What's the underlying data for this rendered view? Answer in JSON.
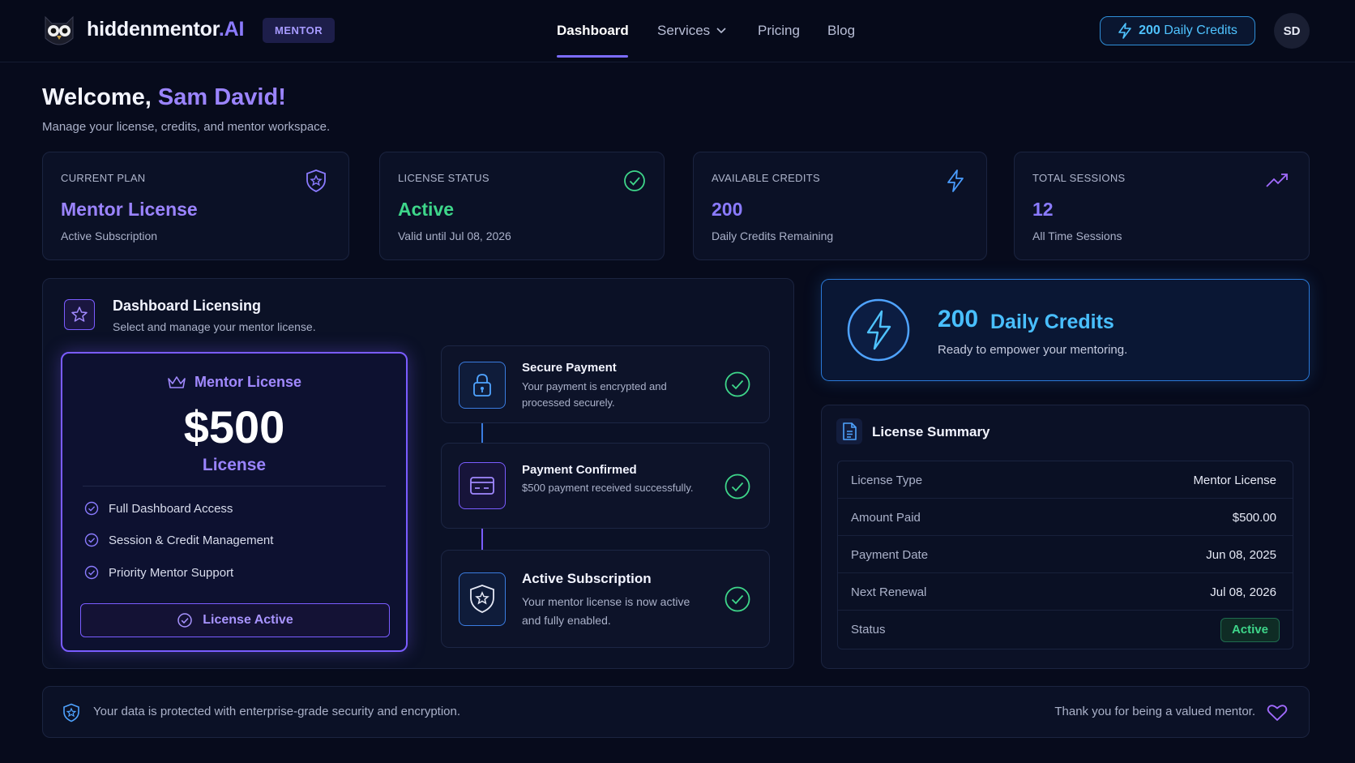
{
  "header": {
    "brand_main": "hiddenmentor",
    "brand_suffix": ".AI",
    "role_badge": "MENTOR",
    "nav": [
      {
        "label": "Dashboard",
        "active": true
      },
      {
        "label": "Services",
        "dropdown": true
      },
      {
        "label": "Pricing"
      },
      {
        "label": "Blog"
      }
    ],
    "credits_value": "200",
    "credits_label": "Daily Credits",
    "avatar_initials": "SD"
  },
  "welcome": {
    "greeting": "Welcome,",
    "name": "Sam David!",
    "subtitle": "Manage your license, credits, and mentor workspace."
  },
  "stats": [
    {
      "label": "CURRENT PLAN",
      "value": "Mentor License",
      "sub": "Active Subscription",
      "color": "#9b84ff",
      "icon": "shield-star-icon"
    },
    {
      "label": "LICENSE STATUS",
      "value": "Active",
      "sub": "Valid until Jul 08, 2026",
      "color": "#3ed68a",
      "icon": "check-circle-icon"
    },
    {
      "label": "AVAILABLE CREDITS",
      "value": "200",
      "sub": "Daily Credits Remaining",
      "color": "#8b7bff",
      "icon": "lightning-icon"
    },
    {
      "label": "TOTAL SESSIONS",
      "value": "12",
      "sub": "All Time Sessions",
      "color": "#8b7bff",
      "icon": "trending-up-icon"
    }
  ],
  "licensing": {
    "title": "Dashboard Licensing",
    "subtitle": "Select and manage your mentor license.",
    "plan": {
      "name": "Mentor License",
      "price": "$500",
      "price_label": "License",
      "features": [
        "Full Dashboard Access",
        "Session & Credit Management",
        "Priority Mentor Support"
      ],
      "button_label": "License Active"
    },
    "steps": [
      {
        "title": "Secure Payment",
        "desc": "Your payment is encrypted and processed securely.",
        "icon": "lock-icon"
      },
      {
        "title": "Payment Confirmed",
        "desc": "$500 payment received successfully.",
        "icon": "credit-card-icon"
      },
      {
        "title": "Active Subscription",
        "desc": "Your mentor license is now active and fully enabled.",
        "icon": "shield-star-icon"
      }
    ]
  },
  "daily_credits": {
    "value": "200",
    "label": "Daily Credits",
    "subtitle": "Ready to empower your mentoring."
  },
  "summary": {
    "title": "License Summary",
    "rows": [
      {
        "key": "License Type",
        "value": "Mentor License"
      },
      {
        "key": "Amount Paid",
        "value": "$500.00"
      },
      {
        "key": "Payment Date",
        "value": "Jun 08, 2025"
      },
      {
        "key": "Next Renewal",
        "value": "Jul 08, 2026"
      },
      {
        "key": "Status",
        "value": "Active"
      }
    ]
  },
  "footer": {
    "left_text": "Your data is protected with enterprise-grade security and encryption.",
    "right_text": "Thank you for being a valued mentor."
  },
  "colors": {
    "accent_purple": "#7a5cff",
    "accent_blue": "#2a79d8",
    "success": "#3ed68a",
    "background": "#070b1c"
  }
}
